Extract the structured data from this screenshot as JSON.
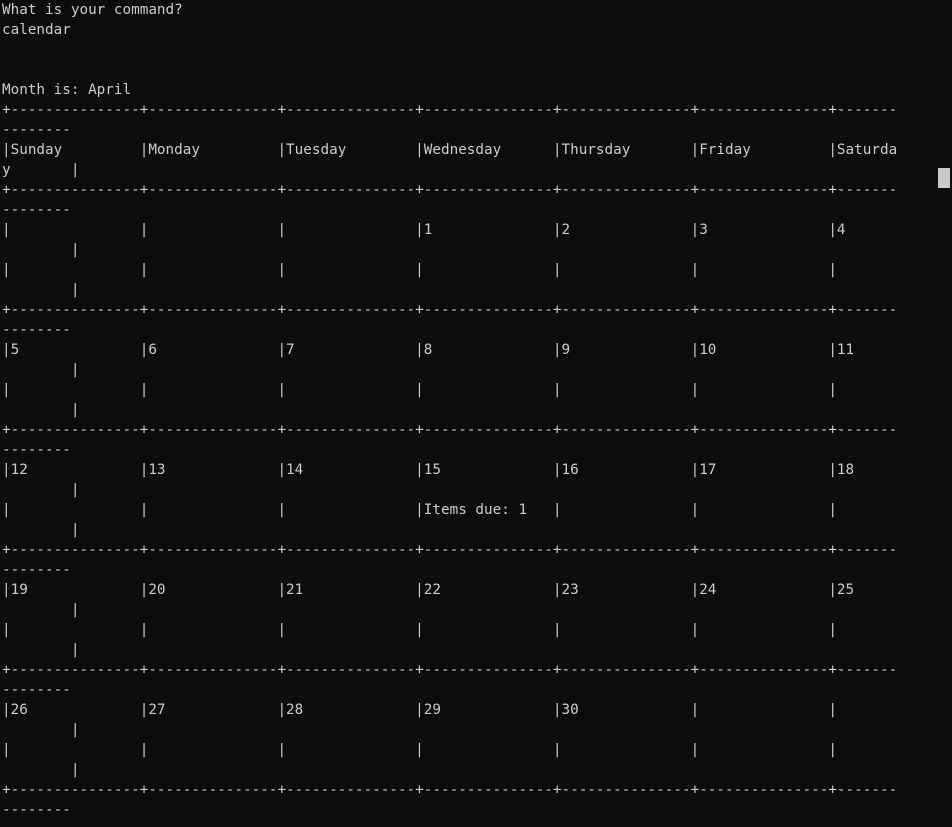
{
  "terminal": {
    "lines": [
      "What is your command?",
      "calendar",
      "",
      "",
      "Month is: April",
      "+---------------+---------------+---------------+---------------+---------------+---------------+-------",
      "--------",
      "|Sunday         |Monday         |Tuesday        |Wednesday      |Thursday       |Friday         |Saturda",
      "y       |",
      "+---------------+---------------+---------------+---------------+---------------+---------------+-------",
      "--------",
      "|               |               |               |1              |2              |3              |4",
      "        |",
      "|               |               |               |               |               |               |",
      "        |",
      "+---------------+---------------+---------------+---------------+---------------+---------------+-------",
      "--------",
      "|5              |6              |7              |8              |9              |10             |11",
      "        |",
      "|               |               |               |               |               |               |",
      "        |",
      "+---------------+---------------+---------------+---------------+---------------+---------------+-------",
      "--------",
      "|12             |13             |14             |15             |16             |17             |18",
      "        |",
      "|               |               |               |Items due: 1   |               |               |",
      "        |",
      "+---------------+---------------+---------------+---------------+---------------+---------------+-------",
      "--------",
      "|19             |20             |21             |22             |23             |24             |25",
      "        |",
      "|               |               |               |               |               |               |",
      "        |",
      "+---------------+---------------+---------------+---------------+---------------+---------------+-------",
      "--------",
      "|26             |27             |28             |29             |30             |               |",
      "        |",
      "|               |               |               |               |               |               |",
      "        |",
      "+---------------+---------------+---------------+---------------+---------------+---------------+-------",
      "--------"
    ]
  },
  "colors": {
    "background": "#0c0c0c",
    "foreground": "#cccccc",
    "scrollbar_thumb": "#c8c8c8"
  }
}
